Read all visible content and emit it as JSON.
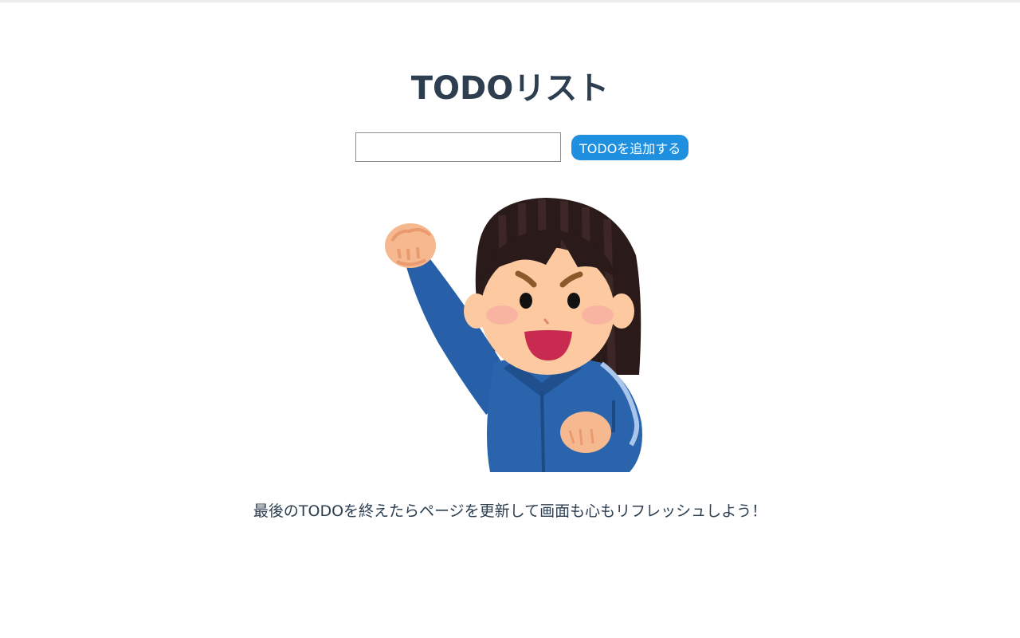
{
  "header": {
    "title": "TODOリスト"
  },
  "form": {
    "input_value": "",
    "input_placeholder": "",
    "add_button_label": "TODOを追加する"
  },
  "illustration": {
    "icon": "cheering-girl-illustration"
  },
  "footer": {
    "message": "最後のTODOを終えたらページを更新して画面も心もリフレッシュしよう！"
  },
  "colors": {
    "title_text": "#2c3e50",
    "button_bg": "#1f8fe0",
    "button_text": "#ffffff"
  }
}
